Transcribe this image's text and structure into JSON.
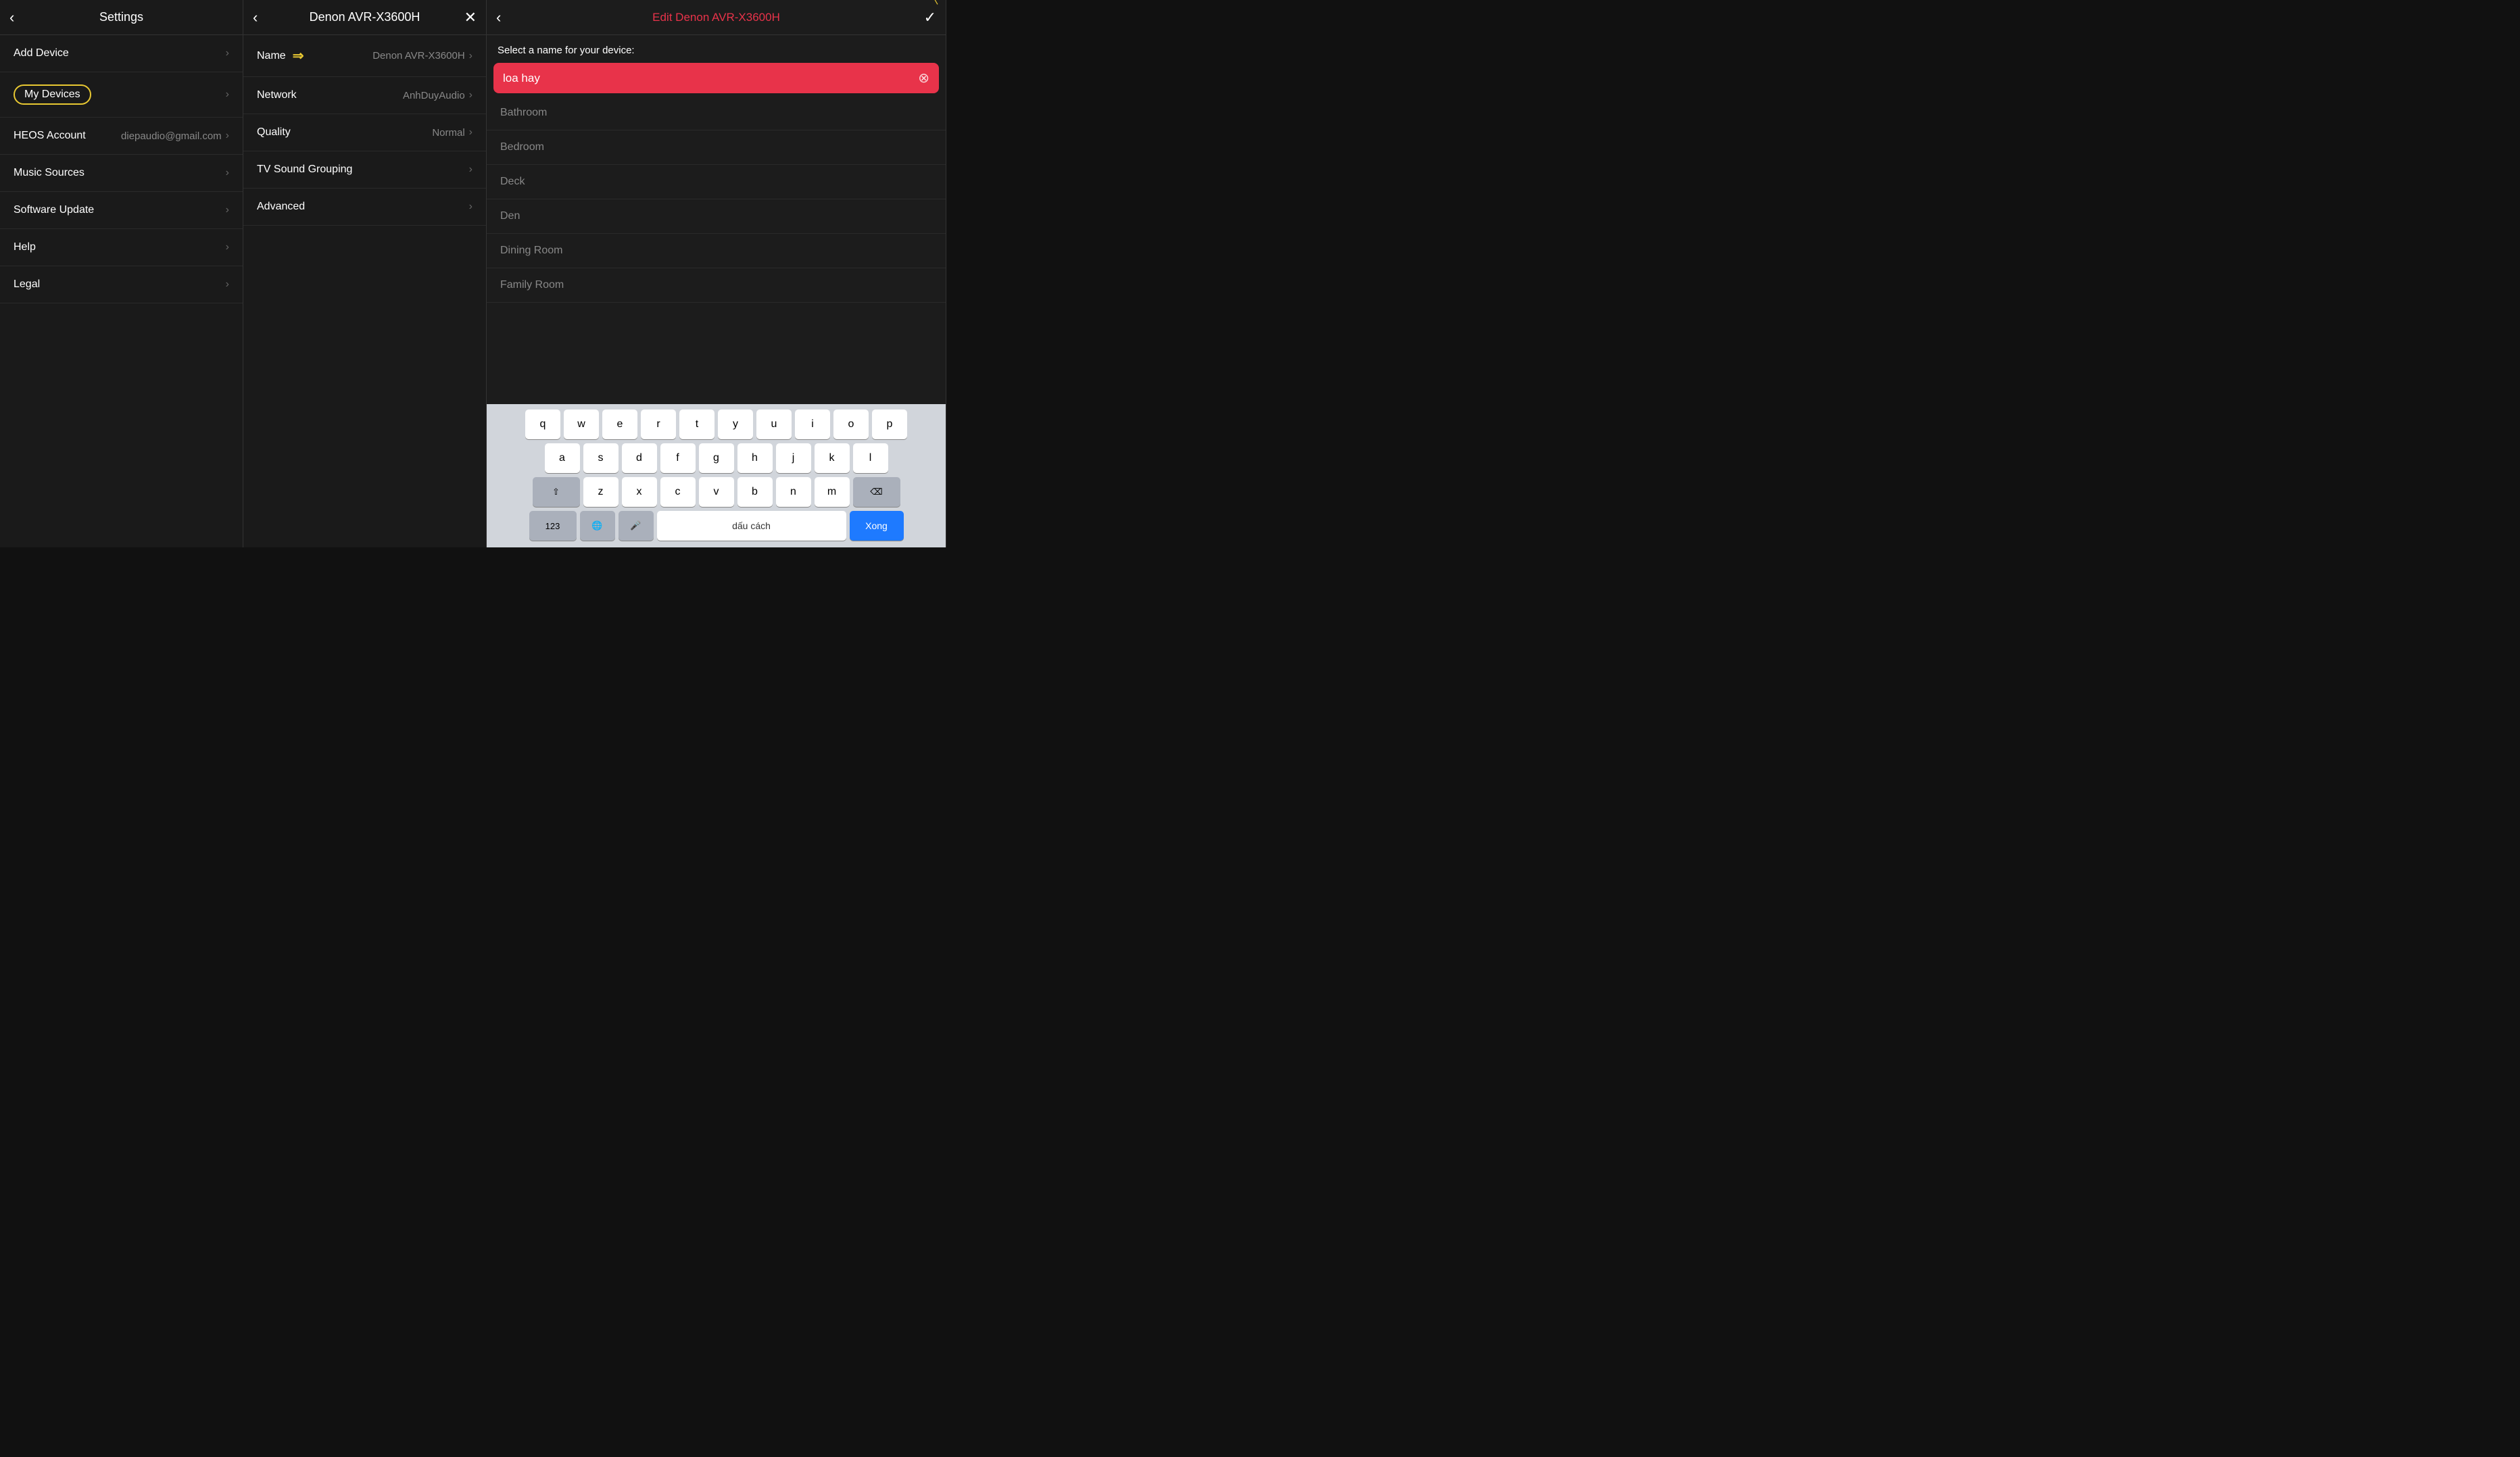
{
  "panel1": {
    "header": {
      "back_label": "‹",
      "title": "Settings"
    },
    "items": [
      {
        "id": "add-device",
        "label": "Add Device",
        "value": "",
        "circled": false
      },
      {
        "id": "my-devices",
        "label": "My Devices",
        "value": "",
        "circled": true
      },
      {
        "id": "heos-account",
        "label": "HEOS Account",
        "value": "diepaudio@gmail.com",
        "circled": false
      },
      {
        "id": "music-sources",
        "label": "Music Sources",
        "value": "",
        "circled": false
      },
      {
        "id": "software-update",
        "label": "Software Update",
        "value": "",
        "circled": false
      },
      {
        "id": "help",
        "label": "Help",
        "value": "",
        "circled": false
      },
      {
        "id": "legal",
        "label": "Legal",
        "value": "",
        "circled": false
      }
    ]
  },
  "panel2": {
    "header": {
      "back_label": "‹",
      "title": "Denon AVR-X3600H",
      "close_label": "✕"
    },
    "items": [
      {
        "id": "name",
        "label": "Name",
        "value": "Denon AVR-X3600H",
        "has_arrow_icon": true
      },
      {
        "id": "network",
        "label": "Network",
        "value": "AnhDuyAudio"
      },
      {
        "id": "quality",
        "label": "Quality",
        "value": "Normal"
      },
      {
        "id": "tv-sound",
        "label": "TV Sound Grouping",
        "value": ""
      },
      {
        "id": "advanced",
        "label": "Advanced",
        "value": ""
      }
    ]
  },
  "panel3": {
    "header": {
      "back_label": "‹",
      "title": "Edit Denon AVR-X3600H",
      "check_label": "✓"
    },
    "select_label": "Select a name for your device:",
    "input_value": "loa hay",
    "rooms": [
      "Bathroom",
      "Bedroom",
      "Deck",
      "Den",
      "Dining Room",
      "Family Room"
    ]
  },
  "keyboard": {
    "row1": [
      "q",
      "w",
      "e",
      "r",
      "t",
      "y",
      "u",
      "i",
      "o",
      "p"
    ],
    "row2": [
      "a",
      "s",
      "d",
      "f",
      "g",
      "h",
      "j",
      "k",
      "l"
    ],
    "row3": [
      "z",
      "x",
      "c",
      "v",
      "b",
      "n",
      "m"
    ],
    "shift_label": "⇧",
    "backspace_label": "⌫",
    "num_label": "123",
    "globe_label": "🌐",
    "mic_label": "🎤",
    "space_label": "dấu cách",
    "done_label": "Xong"
  }
}
